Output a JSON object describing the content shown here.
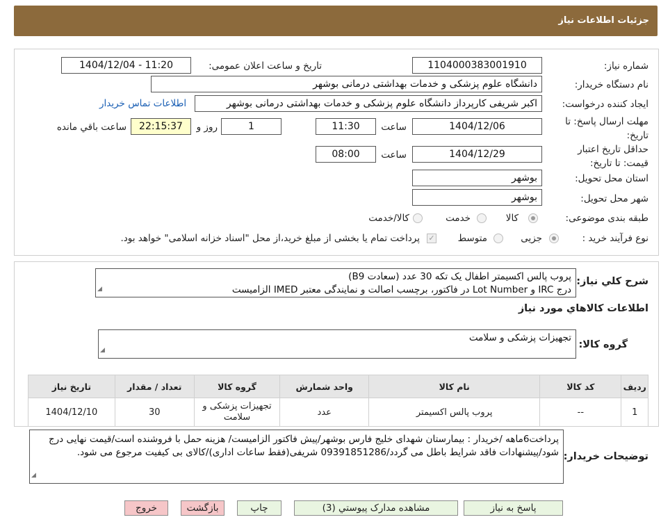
{
  "header": {
    "title": "جزئیات اطلاعات نیاز"
  },
  "fields": {
    "need_number": {
      "label": "شماره نیاز:",
      "value": "1104000383001910"
    },
    "announce_datetime": {
      "label": "تاریخ و ساعت اعلان عمومی:",
      "value": "1404/12/04 - 11:20"
    },
    "buyer_org": {
      "label": "نام دستگاه خریدار:",
      "value": "دانشگاه علوم پزشکی و خدمات بهداشتی درمانی بوشهر"
    },
    "requester": {
      "label": "ایجاد کننده درخواست:",
      "value": "اکبر شریفی کارپرداز دانشگاه علوم پزشکی و خدمات بهداشتی درمانی بوشهر"
    },
    "contact_link": "اطلاعات تماس خریدار",
    "reply_deadline": {
      "label": "مهلت ارسال پاسخ: تا تاریخ:",
      "date": "1404/12/06",
      "time_label": "ساعت",
      "time": "11:30",
      "days": "1",
      "days_label": "روز و",
      "remaining": "22:15:37",
      "remaining_label": "ساعت باقي مانده"
    },
    "price_validity": {
      "label": "حداقل تاریخ اعتبار قیمت: تا تاریخ:",
      "date": "1404/12/29",
      "time_label": "ساعت",
      "time": "08:00"
    },
    "delivery_province": {
      "label": "استان محل تحویل:",
      "value": "بوشهر"
    },
    "delivery_city": {
      "label": "شهر محل تحویل:",
      "value": "بوشهر"
    },
    "category": {
      "label": "طبقه بندی موضوعی:",
      "options": [
        "کالا",
        "خدمت",
        "کالا/خدمت"
      ],
      "selected": "کالا"
    },
    "process_type": {
      "label": "نوع فرآیند خرید :",
      "options": [
        "جزیی",
        "متوسط"
      ],
      "selected": "جزیی",
      "note": "پرداخت تمام یا بخشی از مبلغ خرید،از محل \"اسناد خزانه اسلامی\" خواهد بود."
    }
  },
  "description": {
    "label": "شرح كلي نياز:",
    "line1": "پروب پالس اکسیمتر اطفال یک تکه 30 عدد (سعادت B9)",
    "line2": "درج IRC و Lot Number در فاکتور، برچسب اصالت و نمایندگی معتبر IMED الزامیست"
  },
  "goods_info": {
    "heading": "اطلاعات کالاهاي مورد نياز",
    "group_label": "گروه کالا:",
    "group_value": "تجهیزات پزشکی و سلامت"
  },
  "table": {
    "headers": [
      "رديف",
      "کد کالا",
      "نام کالا",
      "واحد شمارش",
      "گروه کالا",
      "تعداد / مقدار",
      "تاریخ نیاز"
    ],
    "rows": [
      [
        "1",
        "--",
        "پروب پالس اکسیمتر",
        "عدد",
        "تجهیزات پزشکی و سلامت",
        "30",
        "1404/12/10"
      ]
    ]
  },
  "buyer_notes": {
    "label": "توضیحات خریدار:",
    "text": "پرداخت6ماهه /خریدار : بیمارستان شهدای خلیج فارس بوشهر/پیش فاکتور الزامیست/ هزینه حمل با فروشنده است/قیمت نهایی درج شود/پیشنهادات فاقد شرایط باطل می گردد/09391851286 شریفی(فقط ساعات اداری)/کالای بی کیفیت مرجوع می شود."
  },
  "buttons": {
    "reply": "پاسخ به نیاز",
    "attachments": "مشاهده مدارک پیوستي (3)",
    "print": "چاپ",
    "back": "بازگشت",
    "exit": "خروج"
  },
  "colors": {
    "header_bg": "#8c6a3c",
    "timer_bg": "#ffffcc",
    "link": "#1a5fb4",
    "button_green": "#e9f5e1",
    "button_red": "#f6c6c8"
  }
}
